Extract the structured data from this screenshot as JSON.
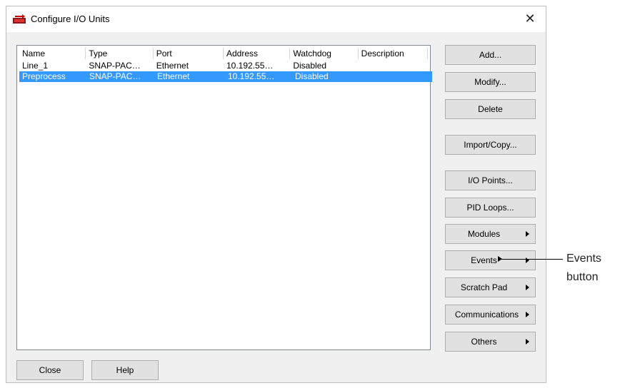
{
  "window": {
    "title": "Configure I/O Units",
    "close_glyph": "✕"
  },
  "table": {
    "columns": [
      "Name",
      "Type",
      "Port",
      "Address",
      "Watchdog",
      "Description"
    ],
    "rows": [
      {
        "name": "Line_1",
        "type": "SNAP-PAC…",
        "port": "Ethernet",
        "address": "10.192.55…",
        "watchdog": "Disabled",
        "description": "",
        "selected": false
      },
      {
        "name": "Preprocess",
        "type": "SNAP-PAC…",
        "port": "Ethernet",
        "address": "10.192.55…",
        "watchdog": "Disabled",
        "description": "",
        "selected": true
      }
    ]
  },
  "buttons": {
    "add": "Add...",
    "modify": "Modify...",
    "delete": "Delete",
    "import_copy": "Import/Copy...",
    "io_points": "I/O Points...",
    "pid_loops": "PID Loops...",
    "modules": "Modules",
    "events": "Events",
    "scratch_pad": "Scratch Pad",
    "communications": "Communications",
    "others": "Others",
    "close": "Close",
    "help": "Help"
  },
  "callout": {
    "line1": "Events",
    "line2": "button"
  },
  "colors": {
    "selection": "#3399ff",
    "dialog_bg": "#f0f0f0",
    "button_bg": "#e1e1e1"
  }
}
